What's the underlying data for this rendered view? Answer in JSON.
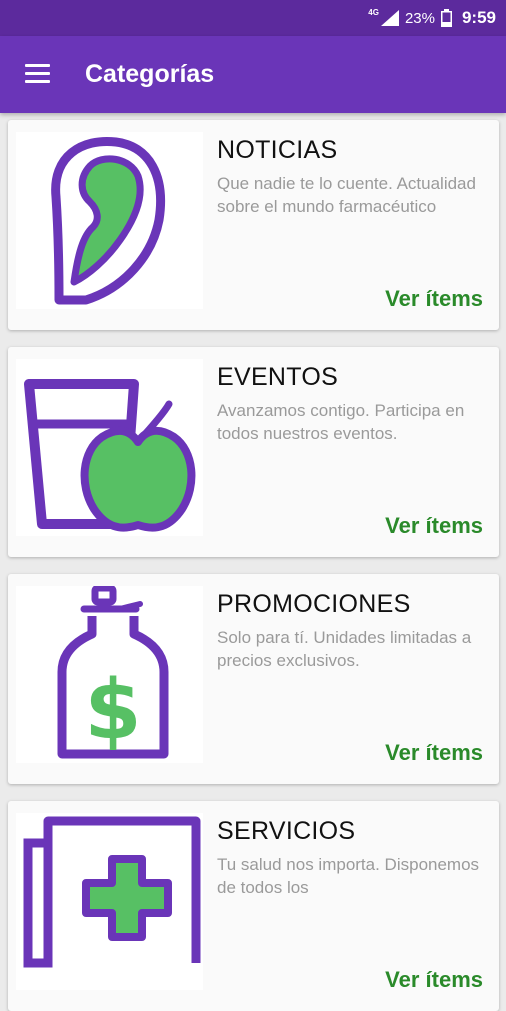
{
  "status_bar": {
    "network": "4G",
    "battery": "23%",
    "time": "9:59"
  },
  "app_bar": {
    "title": "Categorías"
  },
  "colors": {
    "primary": "#6a35b8",
    "primary_dark": "#5c2a9d",
    "accent_green": "#2a8a2a",
    "icon_purple": "#6a35b8",
    "icon_green": "#57c064"
  },
  "categories": [
    {
      "title": "NOTICIAS",
      "description": "Que nadie te lo cuente. Actualidad sobre el mundo farmacéutico",
      "action": "Ver ítems",
      "icon": "ear-icon"
    },
    {
      "title": "EVENTOS",
      "description": "Avanzamos contigo. Participa en todos nuestros eventos.",
      "action": "Ver ítems",
      "icon": "glass-apple-icon"
    },
    {
      "title": "PROMOCIONES",
      "description": "Solo para tí. Unidades limitadas a precios exclusivos.",
      "action": "Ver ítems",
      "icon": "dollar-bottle-icon"
    },
    {
      "title": "SERVICIOS",
      "description": "Tu salud nos importa. Disponemos de todos los",
      "action": "Ver ítems",
      "icon": "medical-cross-icon"
    }
  ]
}
